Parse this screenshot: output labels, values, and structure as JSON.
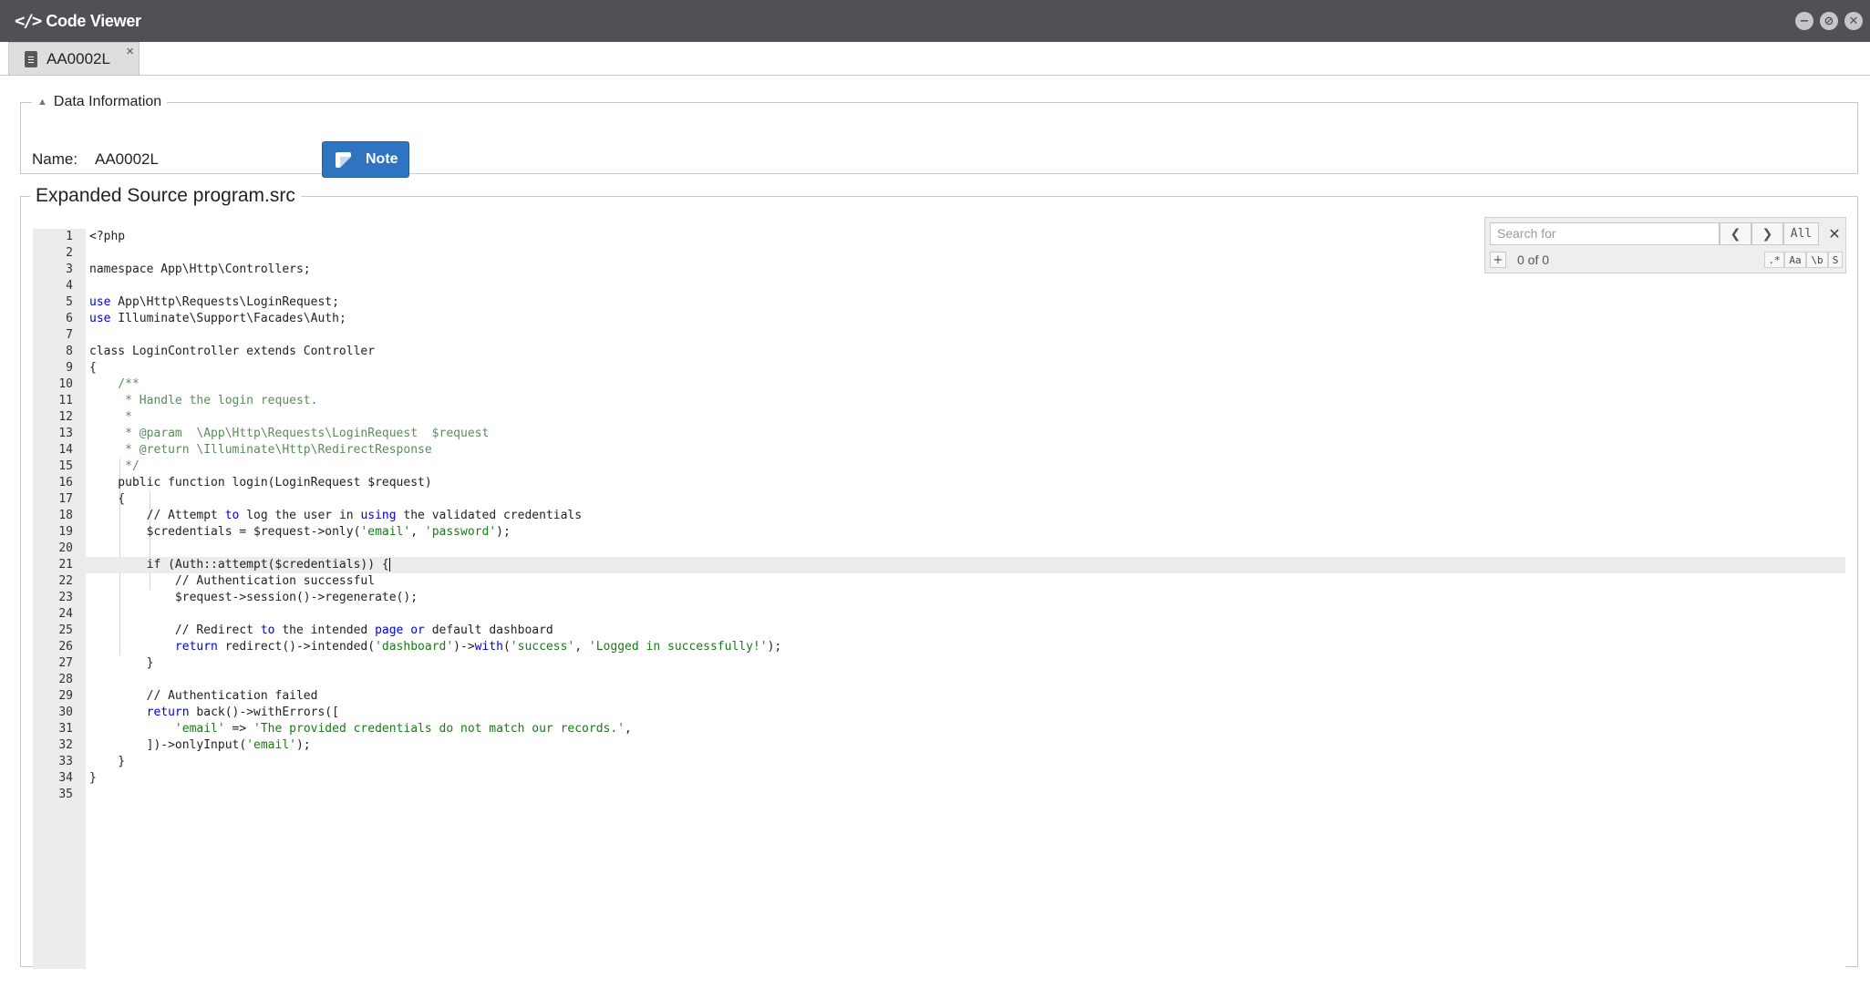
{
  "window": {
    "title_icon": "</>",
    "title": "Code Viewer",
    "controls": {
      "minimize": "−",
      "restore": "⊘",
      "close": "✕"
    }
  },
  "tab": {
    "label": "AA0002L",
    "close": "×"
  },
  "data_info": {
    "legend": "Data Information",
    "name_label": "Name:",
    "name_value": "AA0002L",
    "note_label": "Note"
  },
  "source": {
    "legend": "Expanded Source program.src",
    "active_line": 21,
    "lines": [
      [
        [
          "t",
          "<?php"
        ]
      ],
      [],
      [
        [
          "t",
          "namespace App\\Http\\Controllers;"
        ]
      ],
      [],
      [
        [
          "k",
          "use"
        ],
        [
          "t",
          " App\\Http\\Requests\\LoginRequest;"
        ]
      ],
      [
        [
          "k",
          "use"
        ],
        [
          "t",
          " Illuminate\\Support\\Facades\\Auth;"
        ]
      ],
      [],
      [
        [
          "t",
          "class LoginController extends Controller"
        ]
      ],
      [
        [
          "t",
          "{"
        ]
      ],
      [
        [
          "c",
          "    /**"
        ]
      ],
      [
        [
          "c",
          "     * Handle the login request."
        ]
      ],
      [
        [
          "c",
          "     *"
        ]
      ],
      [
        [
          "c",
          "     * @param  \\App\\Http\\Requests\\LoginRequest  $request"
        ]
      ],
      [
        [
          "c",
          "     * @return \\Illuminate\\Http\\RedirectResponse"
        ]
      ],
      [
        [
          "c",
          "     */"
        ]
      ],
      [
        [
          "t",
          "    public function login(LoginRequest $request)"
        ]
      ],
      [
        [
          "t",
          "    {"
        ]
      ],
      [
        [
          "t",
          "        // Attempt "
        ],
        [
          "k",
          "to"
        ],
        [
          "t",
          " log the user in "
        ],
        [
          "k",
          "using"
        ],
        [
          "t",
          " the validated credentials"
        ]
      ],
      [
        [
          "t",
          "        $credentials = $request->only("
        ],
        [
          "s",
          "'email'"
        ],
        [
          "t",
          ", "
        ],
        [
          "s",
          "'password'"
        ],
        [
          "t",
          ");"
        ]
      ],
      [],
      [
        [
          "t",
          "        if (Auth::attempt($credentials)) {"
        ],
        [
          "cur",
          ""
        ]
      ],
      [
        [
          "t",
          "            // Authentication successful"
        ]
      ],
      [
        [
          "t",
          "            $request->session()->regenerate();"
        ]
      ],
      [],
      [
        [
          "t",
          "            // Redirect "
        ],
        [
          "k",
          "to"
        ],
        [
          "t",
          " the intended "
        ],
        [
          "k",
          "page"
        ],
        [
          "t",
          " "
        ],
        [
          "k",
          "or"
        ],
        [
          "t",
          " default dashboard"
        ]
      ],
      [
        [
          "t",
          "            "
        ],
        [
          "k",
          "return"
        ],
        [
          "t",
          " redirect()->intended("
        ],
        [
          "s",
          "'dashboard'"
        ],
        [
          "t",
          ")->"
        ],
        [
          "k",
          "with"
        ],
        [
          "t",
          "("
        ],
        [
          "s",
          "'success'"
        ],
        [
          "t",
          ", "
        ],
        [
          "s",
          "'Logged in successfully!'"
        ],
        [
          "t",
          ");"
        ]
      ],
      [
        [
          "t",
          "        }"
        ]
      ],
      [],
      [
        [
          "t",
          "        // Authentication failed"
        ]
      ],
      [
        [
          "t",
          "        "
        ],
        [
          "k",
          "return"
        ],
        [
          "t",
          " back()->withErrors(["
        ]
      ],
      [
        [
          "t",
          "            "
        ],
        [
          "s",
          "'email'"
        ],
        [
          "t",
          " => "
        ],
        [
          "s",
          "'The provided credentials do not match our records.'"
        ],
        [
          "t",
          ","
        ]
      ],
      [
        [
          "t",
          "        ])->onlyInput("
        ],
        [
          "s",
          "'email'"
        ],
        [
          "t",
          ");"
        ]
      ],
      [
        [
          "t",
          "    }"
        ]
      ],
      [
        [
          "t",
          "}"
        ]
      ],
      []
    ]
  },
  "search": {
    "placeholder": "Search for",
    "prev_icon": "❮",
    "next_icon": "❯",
    "all_label": "All",
    "close_icon": "✕",
    "plus_label": "+",
    "count": "0 of 0",
    "options": {
      "regex": ".*",
      "case": "Aa",
      "word": "\\b",
      "selection": "S"
    }
  },
  "colors": {
    "titlebar": "#4f5156",
    "note_button": "#2f74c0",
    "keyword": "#0000dd",
    "comment": "#5d8a5d",
    "string": "#1a7a1a"
  }
}
